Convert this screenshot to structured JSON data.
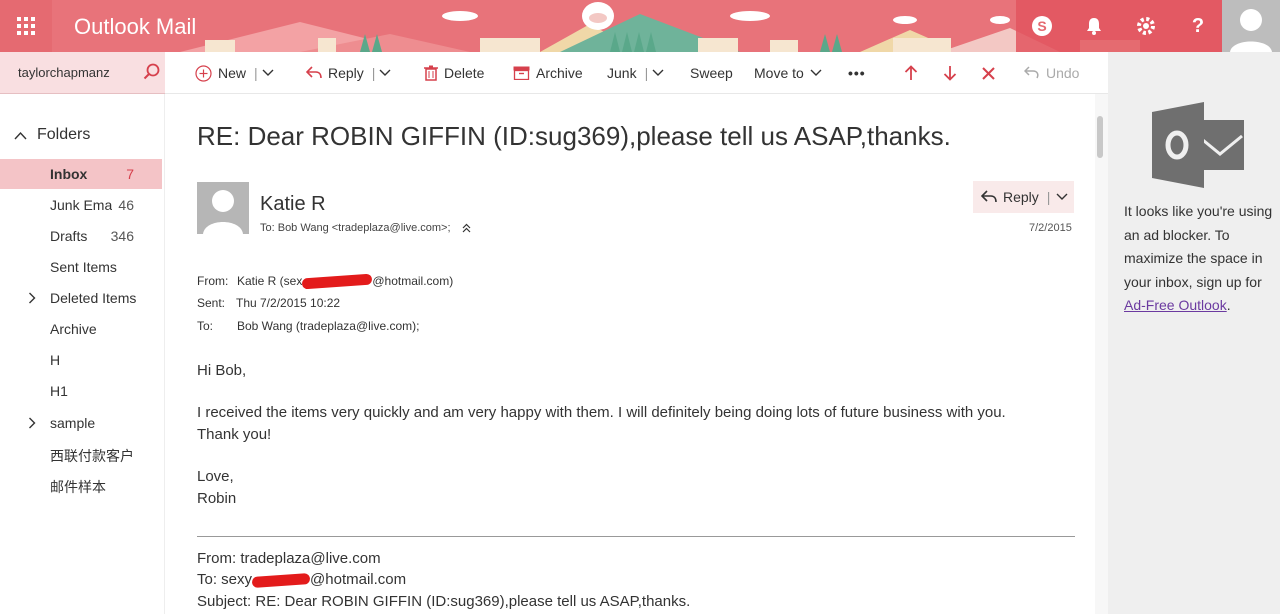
{
  "header": {
    "app_title": "Outlook Mail",
    "colors": {
      "bar": "#e8737a",
      "accent": "#d6404c"
    }
  },
  "search": {
    "value": "taylorchapmanz"
  },
  "toolbar": {
    "new": "New",
    "reply": "Reply",
    "delete": "Delete",
    "archive": "Archive",
    "junk": "Junk",
    "sweep": "Sweep",
    "move_to": "Move to",
    "more": "•••",
    "undo": "Undo"
  },
  "sidebar": {
    "folders_header": "Folders",
    "items": [
      {
        "label": "Inbox",
        "count": "7"
      },
      {
        "label": "Junk Email",
        "count": "46"
      },
      {
        "label": "Drafts",
        "count": "346"
      },
      {
        "label": "Sent Items",
        "count": ""
      },
      {
        "label": "Deleted Items",
        "count": ""
      },
      {
        "label": "Archive",
        "count": ""
      },
      {
        "label": "H",
        "count": ""
      },
      {
        "label": "H1",
        "count": ""
      },
      {
        "label": "sample",
        "count": ""
      },
      {
        "label": "西联付款客户",
        "count": ""
      },
      {
        "label": "邮件样本",
        "count": ""
      }
    ]
  },
  "message": {
    "subject": "RE: Dear ROBIN GIFFIN (ID:sug369),please tell us ASAP,thanks.",
    "sender": "Katie R",
    "to_line": "To: Bob Wang <tradeplaza@live.com>;",
    "date": "7/2/2015",
    "reply_label": "Reply",
    "meta": {
      "from_label": "From:",
      "from_prefix": "Katie R (sex",
      "from_suffix": "@hotmail.com)",
      "sent_label": "Sent:",
      "sent_value": "Thu 7/2/2015 10:22",
      "to_label": "To:",
      "to_value": "Bob Wang (tradeplaza@live.com);"
    },
    "body": {
      "greeting": "Hi Bob,",
      "line1": "I received the items very quickly and am very happy with them. I will definitely being doing lots of future business with you.",
      "line2": "Thank you!",
      "closing": "Love,",
      "signature": "Robin"
    },
    "quoted": {
      "from": "From: tradeplaza@live.com",
      "to_prefix": "To: sexy",
      "to_suffix": "@hotmail.com",
      "subject": "Subject: RE: Dear ROBIN GIFFIN (ID:sug369),please tell us ASAP,thanks."
    }
  },
  "ad_panel": {
    "text": "It looks like you're using an ad blocker. To maximize the space in your inbox, sign up for ",
    "link": "Ad-Free Outlook",
    "suffix": "."
  }
}
